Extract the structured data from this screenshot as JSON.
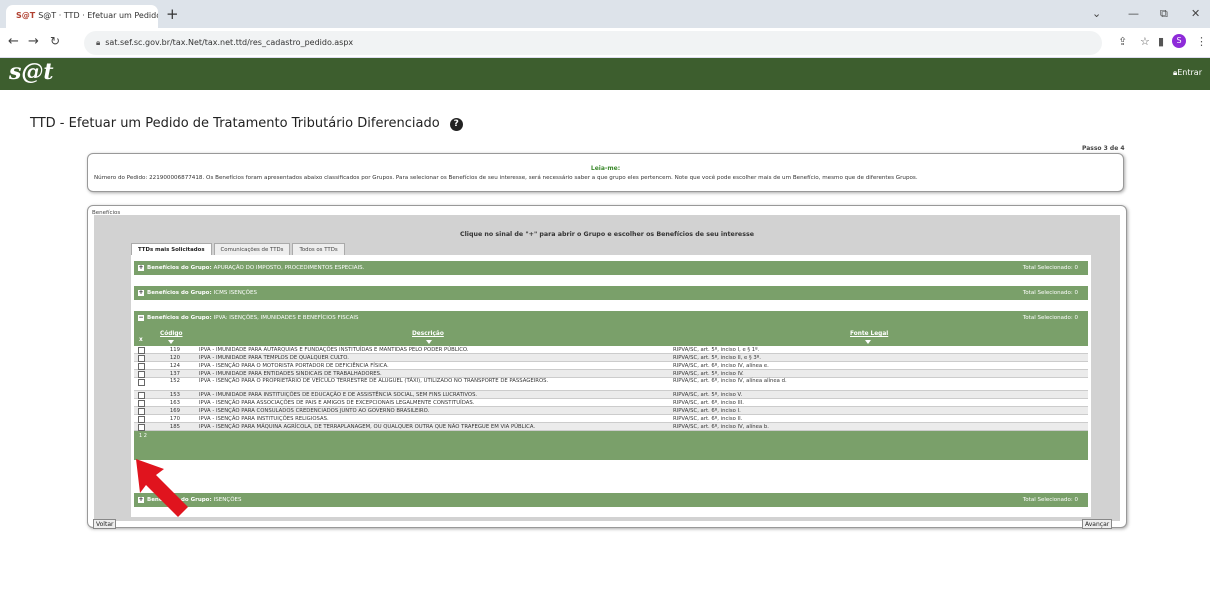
{
  "browser": {
    "tab_title": "S@T · TTD · Efetuar um Pedido ×",
    "favicon": "S@T",
    "url": "sat.sef.sc.gov.br/tax.Net/tax.net.ttd/res_cadastro_pedido.aspx",
    "profile_initial": "S",
    "icons": [
      "back-icon",
      "forward-icon",
      "reload-icon",
      "lock-icon",
      "share-icon",
      "star-icon",
      "sidebar-icon",
      "menu-icon"
    ]
  },
  "header": {
    "logo": "s@t",
    "login": "Entrar"
  },
  "page": {
    "title": "TTD - Efetuar um Pedido de Tratamento Tributário Diferenciado",
    "step": "Passo 3 de 4",
    "leiame_title": "Leia-me:",
    "leiame_text": "Número do Pedido: 221900006877418. Os Benefícios foram apresentados abaixo classificados por Grupos. Para selecionar os Benefícios de seu interesse, será necessário saber a que grupo eles pertencem. Note que você pode escolher mais de um Benefício, mesmo que de diferentes Grupos.",
    "fieldset_label": "Benefícios",
    "hint": "Clique no sinal de \"+\" para abrir o Grupo e escolher os Benefícios de seu interesse",
    "tabs": [
      "TTDs mais Solicitados",
      "Comunicações de TTDs",
      "Todos os TTDs"
    ],
    "groups": [
      {
        "label": "Benefícios do Grupo:",
        "name": "APURAÇÃO DO IMPOSTO, PROCEDIMENTOS ESPECIAIS.",
        "total": "Total Selecionado: 0",
        "sign": "+"
      },
      {
        "label": "Benefícios do Grupo:",
        "name": "ICMS ISENÇÕES",
        "total": "Total Selecionado: 0",
        "sign": "+"
      },
      {
        "label": "Benefícios do Grupo:",
        "name": "IPVA: ISENÇÕES, IMUNIDADES E BENEFÍCIOS FISCAIS",
        "total": "Total Selecionado: 0",
        "sign": "−"
      },
      {
        "label": "Benefícios do Grupo:",
        "name": "ISENÇÕES",
        "total": "Total Selecionado: 0",
        "sign": "+"
      }
    ],
    "table": {
      "col_x": "x",
      "col_codigo": "Código",
      "col_descricao": "Descrição",
      "col_fonte": "Fonte Legal",
      "rows": [
        {
          "codigo": "119",
          "descricao": "IPVA - IMUNIDADE PARA AUTARQUIAS E FUNDAÇÕES INSTITUÍDAS E MANTIDAS PELO PODER PÚBLICO.",
          "fonte": "RIPVA/SC, art. 5º, inciso I, e § 1º."
        },
        {
          "codigo": "120",
          "descricao": "IPVA - IMUNIDADE PARA TEMPLOS DE QUALQUER CULTO.",
          "fonte": "RIPVA/SC, art. 5º, inciso II, e § 3º."
        },
        {
          "codigo": "124",
          "descricao": "IPVA - ISENÇÃO PARA O MOTORISTA PORTADOR DE DEFICIÊNCIA FÍSICA.",
          "fonte": "RIPVA/SC, art. 6º, inciso IV, alínea e."
        },
        {
          "codigo": "137",
          "descricao": "IPVA - IMUNIDADE PARA ENTIDADES SINDICAIS DE TRABALHADORES.",
          "fonte": "RIPVA/SC, art. 5º, inciso IV."
        },
        {
          "codigo": "152",
          "descricao": "IPVA - ISENÇÃO PARA O PROPRIETÁRIO DE VEÍCULO TERRESTRE DE ALUGUEL (TÁXI), UTILIZADO NO TRANSPORTE DE PASSAGEIROS.",
          "fonte": "RIPVA/SC, art. 6º, inciso IV, alínea alínea d."
        },
        {
          "codigo": "153",
          "descricao": "IPVA - IMUNIDADE PARA INSTITUIÇÕES DE EDUCAÇÃO E DE ASSISTÊNCIA SOCIAL, SEM FINS LUCRATIVOS.",
          "fonte": "RIPVA/SC, art. 5º, inciso V."
        },
        {
          "codigo": "163",
          "descricao": "IPVA - ISENÇÃO PARA ASSOCIAÇÕES DE PAIS E AMIGOS DE EXCEPCIONAIS LEGALMENTE CONSTITUÍDAS.",
          "fonte": "RIPVA/SC, art. 6º, inciso III."
        },
        {
          "codigo": "169",
          "descricao": "IPVA - ISENÇÃO PARA CONSULADOS CREDENCIADOS JUNTO AO GOVERNO BRASILEIRO.",
          "fonte": "RIPVA/SC, art. 6º, inciso I."
        },
        {
          "codigo": "170",
          "descricao": "IPVA - ISENÇÃO PARA INSTITUIÇÕES RELIGIOSAS.",
          "fonte": "RIPVA/SC, art. 6º, inciso II."
        },
        {
          "codigo": "185",
          "descricao": "IPVA - ISENÇÃO PARA MÁQUINA AGRÍCOLA, DE TERRAPLANAGEM, OU QUALQUER OUTRA QUE NÃO TRAFEGUE EM VIA PÚBLICA.",
          "fonte": "RIPVA/SC, art. 6º, inciso IV, alínea b."
        }
      ],
      "pager": "1 2"
    },
    "back": "Voltar",
    "next": "Avançar"
  },
  "colors": {
    "header": "#3d5e2e",
    "group": "#7aa06a",
    "arrow": "#e0141e"
  }
}
